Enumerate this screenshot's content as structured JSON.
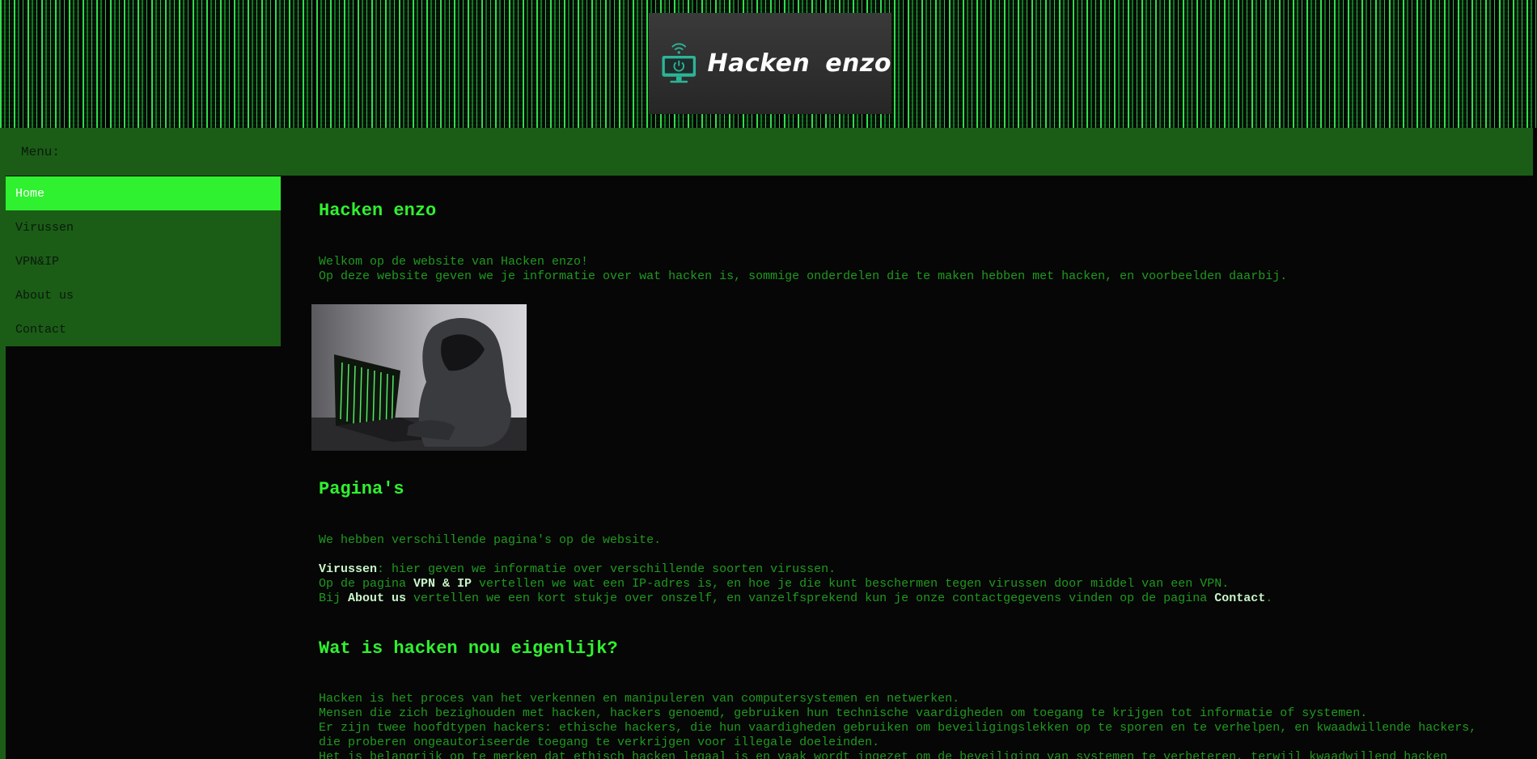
{
  "header": {
    "logo_text": "Hacken enzo",
    "logo_icon": "monitor-power-wifi-icon"
  },
  "menu": {
    "label": "Menu:"
  },
  "sidebar": {
    "items": [
      {
        "label": "Home",
        "active": true
      },
      {
        "label": "Virussen",
        "active": false
      },
      {
        "label": "VPN&IP",
        "active": false
      },
      {
        "label": "About us",
        "active": false
      },
      {
        "label": "Contact",
        "active": false
      }
    ]
  },
  "main": {
    "title": "Hacken enzo",
    "intro": [
      "Welkom op de website van Hacken enzo!",
      "Op deze website geven we je informatie over wat hacken is, sommige onderdelen die te maken hebben met hacken, en voorbeelden daarbij."
    ],
    "image_alt": "hacker-with-laptop-photo",
    "pages_title": "Pagina's",
    "pages_intro": "We hebben verschillende pagina's op de website.",
    "pages_lines": {
      "virussen_strong": "Virussen",
      "virussen_rest": ": hier geven we informatie over verschillende soorten virussen.",
      "vpn_pre": "Op de pagina ",
      "vpn_strong": "VPN & IP",
      "vpn_rest": " vertellen we wat een IP-adres is, en hoe je die kunt beschermen tegen virussen door middel van een VPN.",
      "about_pre": "Bij ",
      "about_strong": "About us",
      "about_mid": " vertellen we een kort stukje over onszelf, en vanzelfsprekend kun je onze contactgegevens vinden op de pagina ",
      "about_contact": "Contact",
      "about_end": "."
    },
    "hacken_title": "Wat is hacken nou eigenlijk?",
    "hacken_lines": [
      "Hacken is het proces van het verkennen en manipuleren van computersystemen en netwerken.",
      "Mensen die zich bezighouden met hacken, hackers genoemd, gebruiken hun technische vaardigheden om toegang te krijgen tot informatie of systemen.",
      "Er zijn twee hoofdtypen hackers: ethische hackers, die hun vaardigheden gebruiken om beveiligingslekken op te sporen en te verhelpen, en kwaadwillende hackers, die proberen ongeautoriseerde toegang te verkrijgen voor illegale doeleinden.",
      "Het is belangrijk op te merken dat ethisch hacken legaal is en vaak wordt ingezet om de beveiliging van systemen te verbeteren, terwijl kwaadwillend hacken"
    ]
  },
  "colors": {
    "menu_bg": "#1b5d17",
    "active_bg": "#2ff12f",
    "heading": "#2ff12f",
    "text": "#1f9a1f",
    "page_bg": "#060606"
  }
}
